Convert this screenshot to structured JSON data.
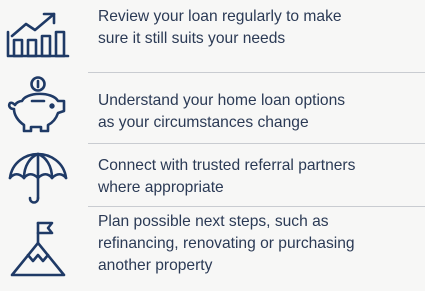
{
  "colors": {
    "icon_stroke": "#1f3a66",
    "text": "#2b3a55",
    "divider": "#c9ccd1",
    "background": "#f7f7f6"
  },
  "items": [
    {
      "icon": "growth-chart-icon",
      "line1": "Review your loan regularly to make",
      "line2": "sure it still suits your needs"
    },
    {
      "icon": "piggy-bank-icon",
      "line1": "Understand your home loan options",
      "line2": "as your circumstances change"
    },
    {
      "icon": "umbrella-icon",
      "line1": "Connect with trusted referral partners",
      "line2": "where appropriate"
    },
    {
      "icon": "mountain-flag-icon",
      "line1": "Plan possible next steps, such as",
      "line2": "refinancing, renovating or purchasing",
      "line3": "another property"
    }
  ]
}
